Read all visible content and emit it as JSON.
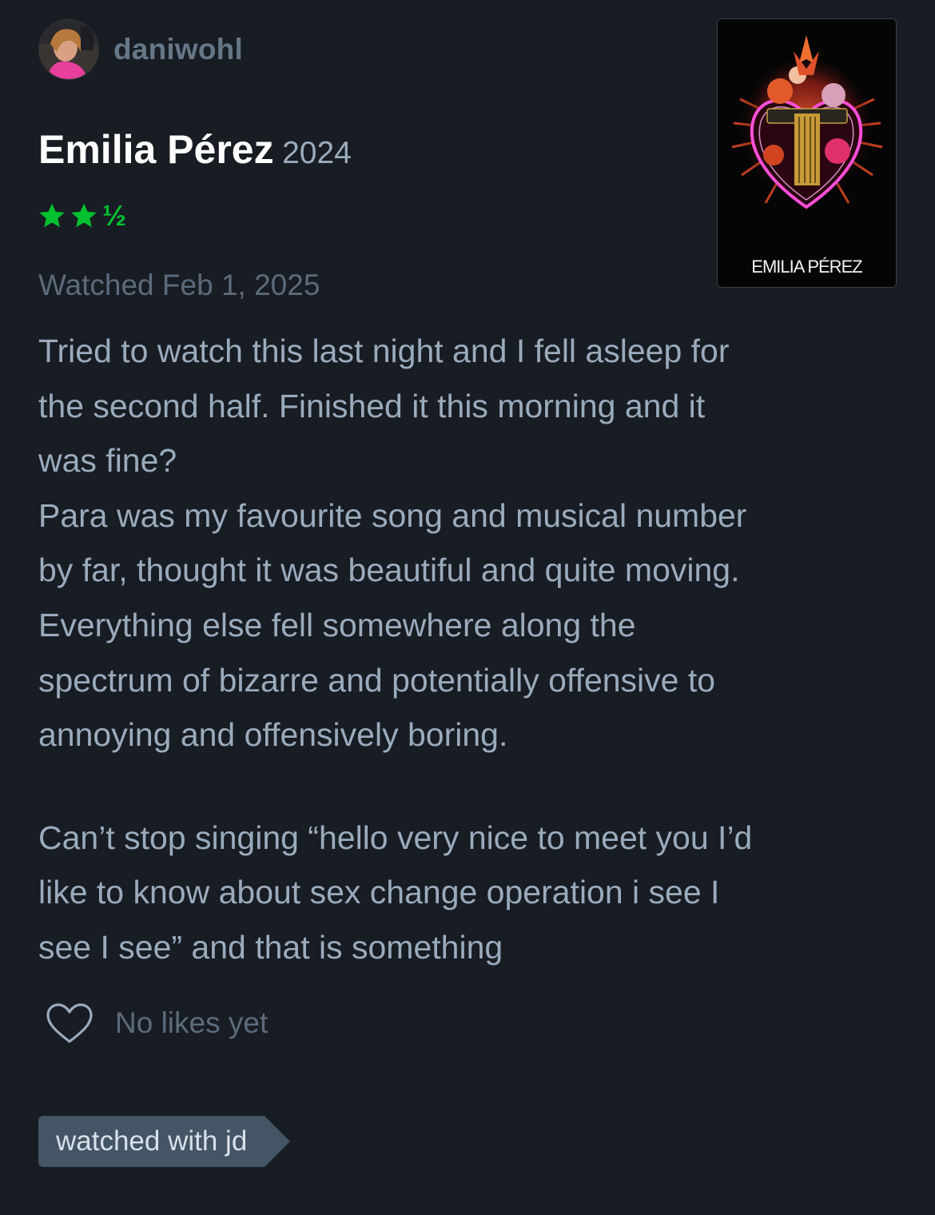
{
  "user": {
    "username": "daniwohl"
  },
  "film": {
    "title": "Emilia Pérez",
    "year": "2024",
    "poster_title": "EMILIA PÉREZ"
  },
  "rating": {
    "stars": 2.5,
    "max": 5,
    "half_glyph": "½",
    "color": "#00c030"
  },
  "watched": {
    "date_text": "Watched Feb 1, 2025"
  },
  "review": {
    "paragraph1": "Tried to watch this last night and I fell asleep for\nthe second half. Finished it this morning and it\nwas fine?\nPara was my favourite song and musical number\nby far, thought it was beautiful and quite moving.\n Everything else fell somewhere along the\nspectrum of bizarre and potentially offensive to\nannoying and offensively boring.",
    "paragraph2": "Can’t stop singing “hello very nice to meet you I’d\nlike to know about sex change operation i see I\nsee I see” and that is something"
  },
  "likes": {
    "icon": "heart-icon",
    "text": "No likes yet"
  },
  "tags": [
    {
      "label": "watched with jd"
    }
  ],
  "colors": {
    "background": "#181c23",
    "accent_green": "#00c030",
    "tag_bg": "#445566"
  }
}
